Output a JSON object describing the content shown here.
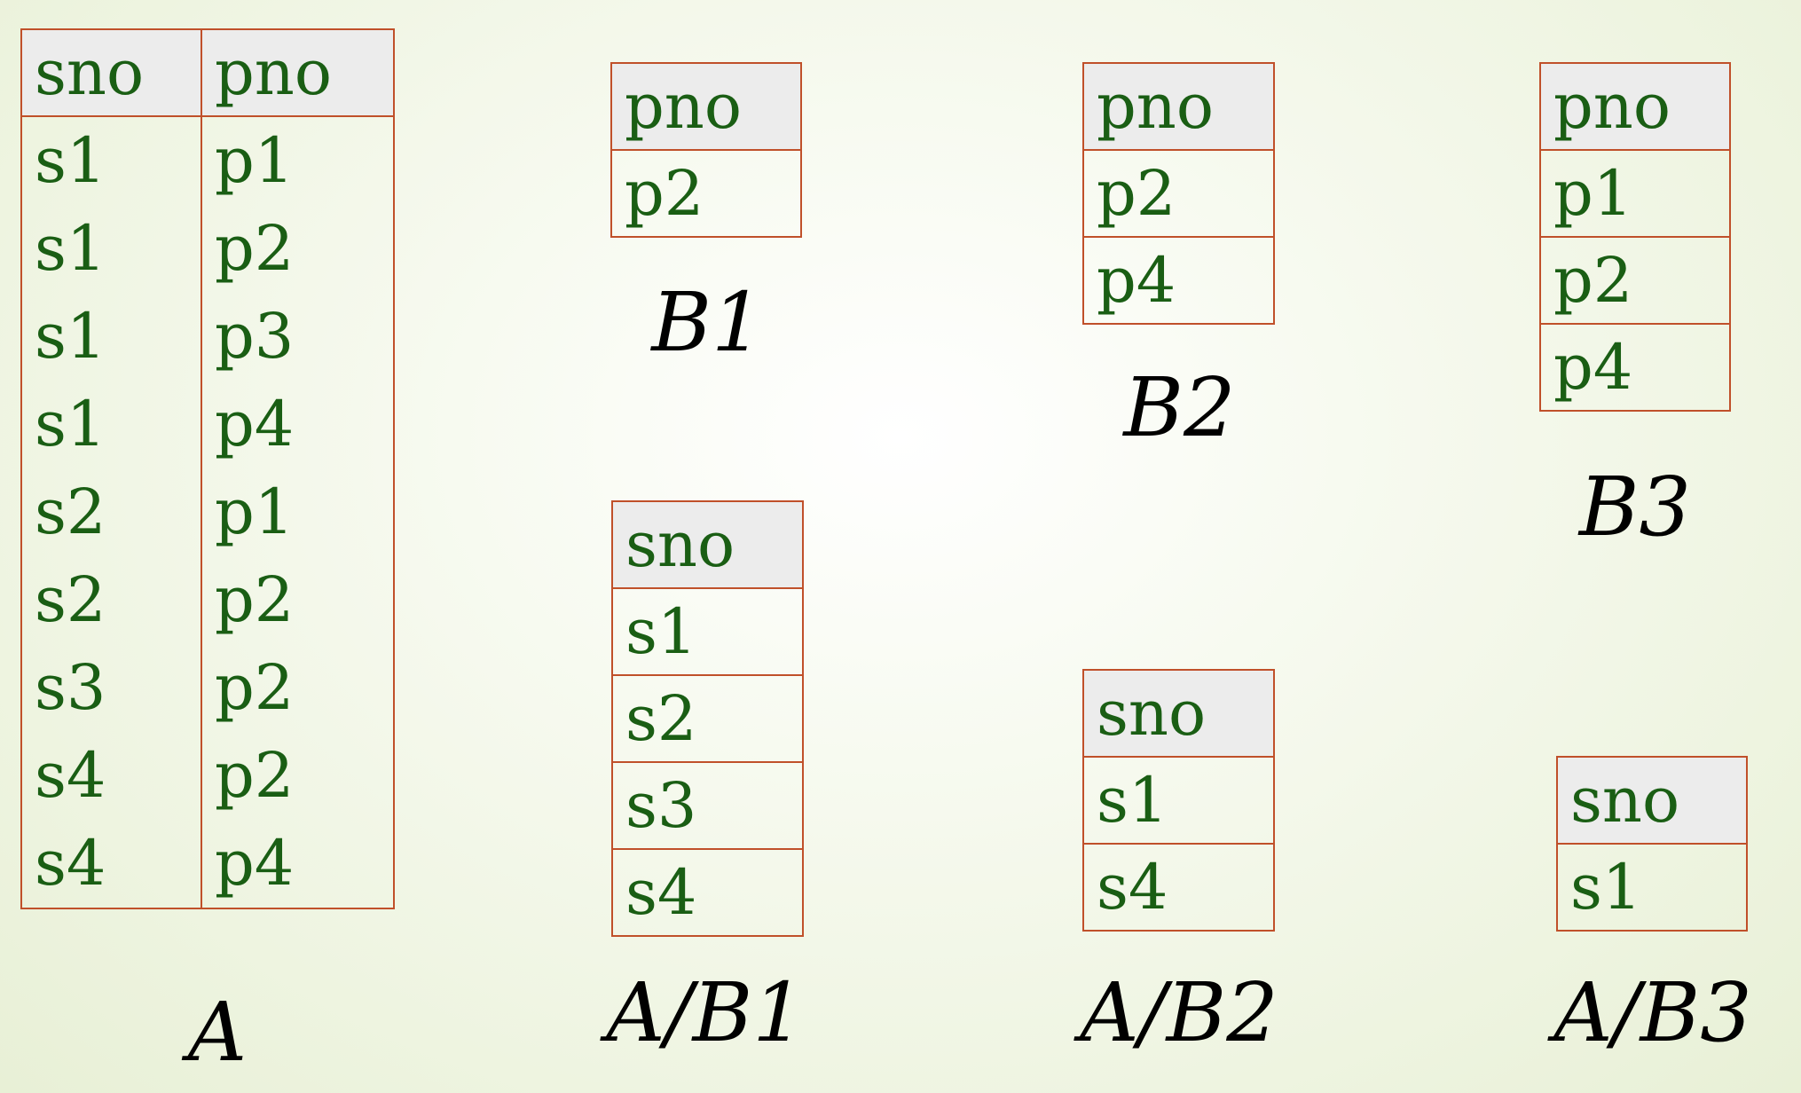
{
  "tables": {
    "A": {
      "name": "A",
      "columns": [
        "sno",
        "pno"
      ],
      "rows": [
        [
          "s1",
          "p1"
        ],
        [
          "s1",
          "p2"
        ],
        [
          "s1",
          "p3"
        ],
        [
          "s1",
          "p4"
        ],
        [
          "s2",
          "p1"
        ],
        [
          "s2",
          "p2"
        ],
        [
          "s3",
          "p2"
        ],
        [
          "s4",
          "p2"
        ],
        [
          "s4",
          "p4"
        ]
      ]
    },
    "B1": {
      "name": "B1",
      "columns": [
        "pno"
      ],
      "rows": [
        [
          "p2"
        ]
      ]
    },
    "B2": {
      "name": "B2",
      "columns": [
        "pno"
      ],
      "rows": [
        [
          "p2"
        ],
        [
          "p4"
        ]
      ]
    },
    "B3": {
      "name": "B3",
      "columns": [
        "pno"
      ],
      "rows": [
        [
          "p1"
        ],
        [
          "p2"
        ],
        [
          "p4"
        ]
      ]
    },
    "A_B1": {
      "name": "A/B1",
      "columns": [
        "sno"
      ],
      "rows": [
        [
          "s1"
        ],
        [
          "s2"
        ],
        [
          "s3"
        ],
        [
          "s4"
        ]
      ]
    },
    "A_B2": {
      "name": "A/B2",
      "columns": [
        "sno"
      ],
      "rows": [
        [
          "s1"
        ],
        [
          "s4"
        ]
      ]
    },
    "A_B3": {
      "name": "A/B3",
      "columns": [
        "sno"
      ],
      "rows": [
        [
          "s1"
        ]
      ]
    }
  },
  "colors": {
    "text": "#1a5e14",
    "border": "#c0502a",
    "header_bg": "#ececec",
    "label": "#000000"
  }
}
